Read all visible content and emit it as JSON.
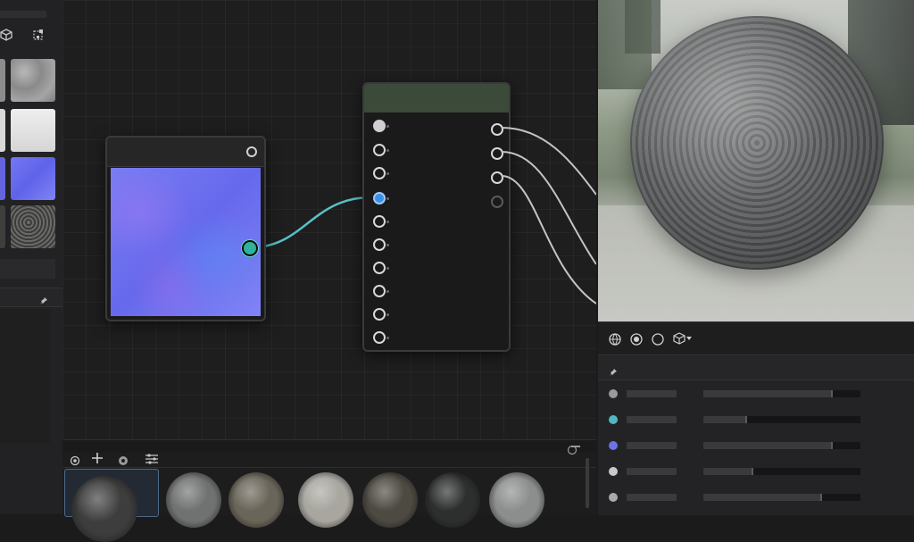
{
  "left_panel": {
    "tools": [
      {
        "icon": "cube-icon"
      },
      {
        "icon": "scatter-cube-icon"
      }
    ],
    "thumbnails": [
      {
        "name": "stone-height-thumbnail",
        "color": "#9a9a9a"
      },
      {
        "name": "white-thumbnail",
        "color": "#e2e2e2"
      },
      {
        "name": "normal-map-thumbnail",
        "color": "#6a6ef2"
      },
      {
        "name": "gravel-thumbnail",
        "color": "#5a5a58"
      }
    ],
    "pin_icon": "pin-icon"
  },
  "texture_node": {
    "header_icon": "circle-icon",
    "preview_color": "#7477f0"
  },
  "material_node": {
    "header_color": "#3b4a39",
    "input_count": 10,
    "output_count": 4
  },
  "connection": {
    "color": "#58c0c6"
  },
  "viewport": {
    "sphere_color": "#5b5d5e"
  },
  "viewport_toolbar": {
    "icons": [
      "globe-icon",
      "material-sphere-icon",
      "circle-outline-icon",
      "cube-dropdown-icon"
    ]
  },
  "properties": {
    "pin_icon": "pin-icon",
    "rows": [
      {
        "dot_color": "#9a9a9a",
        "fill": 0.82
      },
      {
        "dot_color": "#4fb8c0",
        "fill": 0.27
      },
      {
        "dot_color": "#6b73e8",
        "fill": 0.82
      },
      {
        "dot_color": "#c9c9c9",
        "fill": 0.31
      },
      {
        "dot_color": "#a9a9a9",
        "fill": 0.75
      }
    ]
  },
  "shelf": {
    "toolbar_icons": [
      "record-icon",
      "plus-icon",
      "settings-icon",
      "filter-icon"
    ],
    "materials": [
      {
        "name": "asphalt-material",
        "color": "#3c3d3c"
      },
      {
        "name": "concrete-material",
        "color": "#707272"
      },
      {
        "name": "sandstone-material",
        "color": "#6a6559"
      },
      {
        "name": "plaster-material",
        "color": "#a8a69f"
      },
      {
        "name": "mud-material",
        "color": "#4d4a42"
      },
      {
        "name": "dark-rock-material",
        "color": "#2d2e2e"
      },
      {
        "name": "cement-material",
        "color": "#8c8e8e"
      }
    ]
  }
}
